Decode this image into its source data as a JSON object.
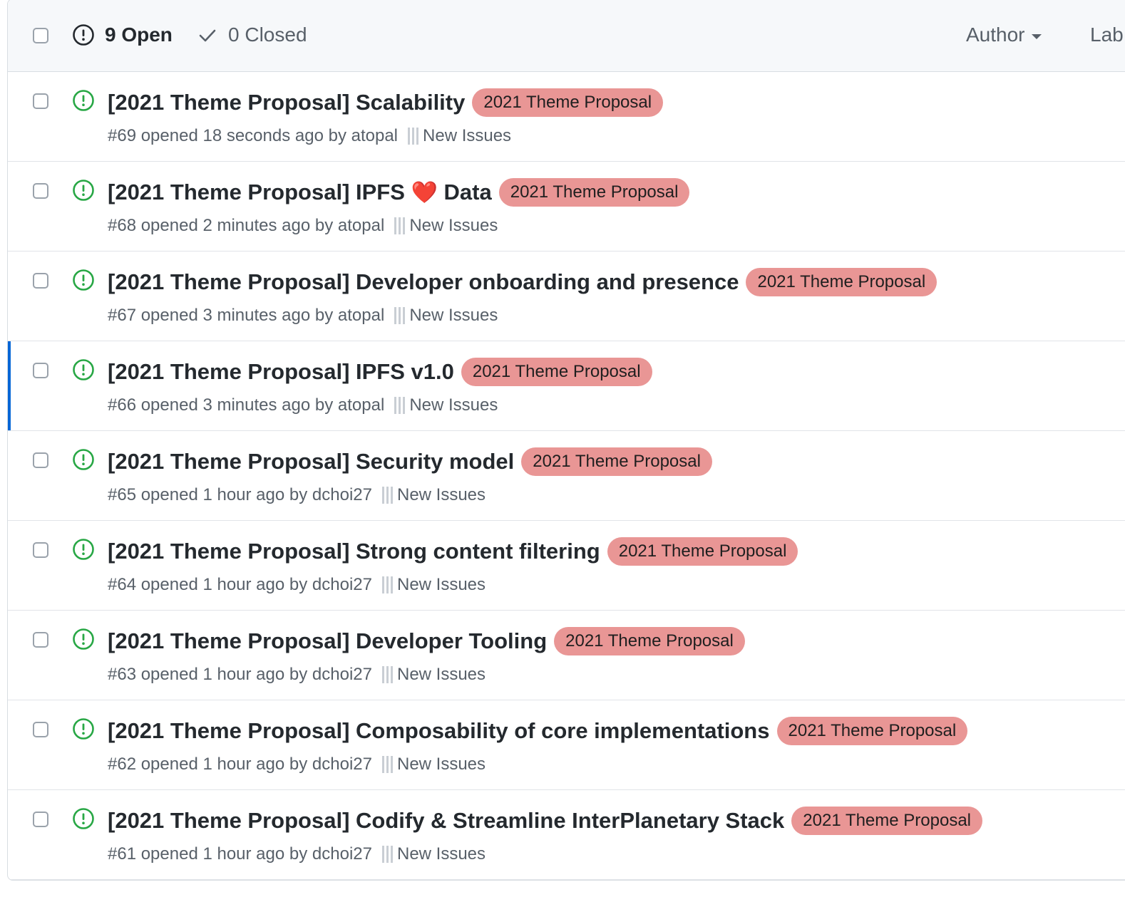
{
  "header": {
    "open_count": "9 Open",
    "closed_count": "0 Closed",
    "filters": {
      "author": "Author",
      "labels": "Lab"
    }
  },
  "colors": {
    "label_bg": "#e99695",
    "open_icon": "#28a745",
    "selected_bar": "#0366d6"
  },
  "issues": [
    {
      "title": "[2021 Theme Proposal] Scalability",
      "label": "2021 Theme Proposal",
      "meta": "#69 opened 18 seconds ago by atopal",
      "project": "New Issues"
    },
    {
      "title": "[2021 Theme Proposal] IPFS",
      "title_emoji": "❤️",
      "title_suffix": "Data",
      "label": "2021 Theme Proposal",
      "meta": "#68 opened 2 minutes ago by atopal",
      "project": "New Issues"
    },
    {
      "title": "[2021 Theme Proposal] Developer onboarding and presence",
      "label": "2021 Theme Proposal",
      "meta": "#67 opened 3 minutes ago by atopal",
      "project": "New Issues"
    },
    {
      "title": "[2021 Theme Proposal] IPFS v1.0",
      "label": "2021 Theme Proposal",
      "meta": "#66 opened 3 minutes ago by atopal",
      "project": "New Issues"
    },
    {
      "title": "[2021 Theme Proposal] Security model",
      "label": "2021 Theme Proposal",
      "meta": "#65 opened 1 hour ago by dchoi27",
      "project": "New Issues"
    },
    {
      "title": "[2021 Theme Proposal] Strong content filtering",
      "label": "2021 Theme Proposal",
      "meta": "#64 opened 1 hour ago by dchoi27",
      "project": "New Issues"
    },
    {
      "title": "[2021 Theme Proposal] Developer Tooling",
      "label": "2021 Theme Proposal",
      "meta": "#63 opened 1 hour ago by dchoi27",
      "project": "New Issues"
    },
    {
      "title": "[2021 Theme Proposal] Composability of core implementations",
      "label": "2021 Theme Proposal",
      "meta": "#62 opened 1 hour ago by dchoi27",
      "project": "New Issues"
    },
    {
      "title": "[2021 Theme Proposal] Codify & Streamline InterPlanetary Stack",
      "label": "2021 Theme Proposal",
      "meta": "#61 opened 1 hour ago by dchoi27",
      "project": "New Issues"
    }
  ]
}
